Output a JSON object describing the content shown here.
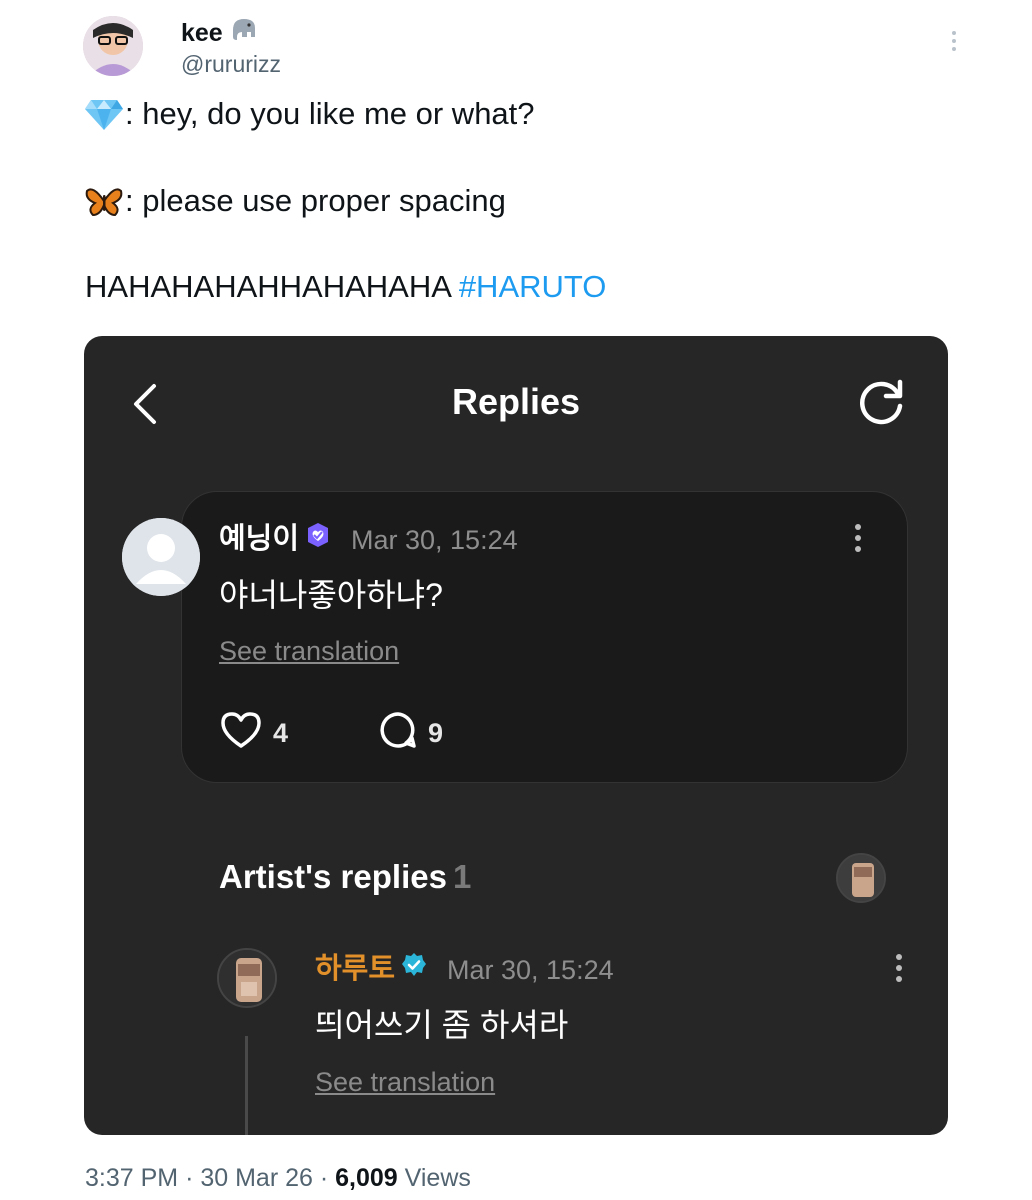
{
  "tweet": {
    "user_name": "kee",
    "user_handle": "@rururizz",
    "line1_text": ": hey, do you like me or what?",
    "line2_text": ": please use proper spacing",
    "line3_text": "HAHAHAHAHHAHAHAHA ",
    "hashtag": "#HARUTO",
    "footer": {
      "time": "3:37 PM",
      "date": "30 Mar 26",
      "views_count": "6,009",
      "views_label": "Views"
    }
  },
  "card": {
    "title": "Replies",
    "comment": {
      "author": "예닝이",
      "time": "Mar 30, 15:24",
      "text": "야너나좋아하냐?",
      "see_translation": "See translation",
      "likes": "4",
      "replies": "9"
    },
    "artist_section": {
      "heading": "Artist's replies",
      "count": "1"
    },
    "artist_reply": {
      "author": "하루토",
      "time": "Mar 30, 15:24",
      "text": "띄어쓰기 좀 하셔라",
      "see_translation": "See translation"
    }
  },
  "colors": {
    "hashtag": "#1d9bf0",
    "card_bg": "#262626",
    "comment_bg": "#1a1a1a",
    "artist_name": "#e2902a",
    "verified_badge": "#2bb5d8",
    "fan_badge": "#7b61ff"
  },
  "icons": [
    "elephant-icon",
    "gem-icon",
    "butterfly-icon",
    "back-arrow-icon",
    "refresh-icon",
    "heart-icon",
    "comment-bubble-icon",
    "fan-badge-icon",
    "verified-badge-icon",
    "more-options-icon"
  ]
}
